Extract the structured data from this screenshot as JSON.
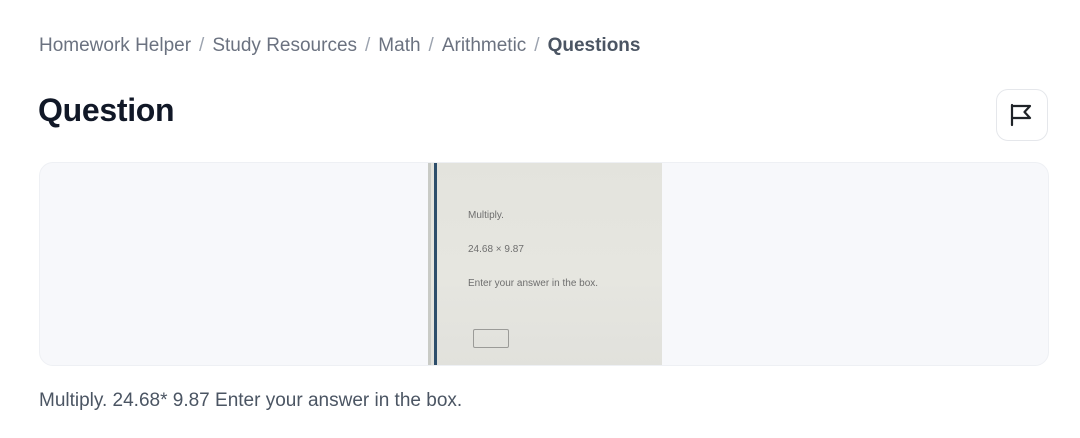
{
  "breadcrumb": {
    "items": [
      "Homework Helper",
      "Study Resources",
      "Math",
      "Arithmetic"
    ],
    "current": "Questions",
    "separator": "/"
  },
  "page": {
    "title": "Question"
  },
  "toolbar": {
    "flag_icon": "flag-icon"
  },
  "question": {
    "image_lines": [
      "Multiply.",
      "24.68 × 9.87",
      "Enter your answer in the box."
    ],
    "text": "Multiply. 24.68* 9.87 Enter your answer in the box."
  },
  "colors": {
    "text_primary": "#111827",
    "text_muted": "#6b7280",
    "card_background": "#f7f8fb",
    "photo_line": "#2d4e6b"
  }
}
